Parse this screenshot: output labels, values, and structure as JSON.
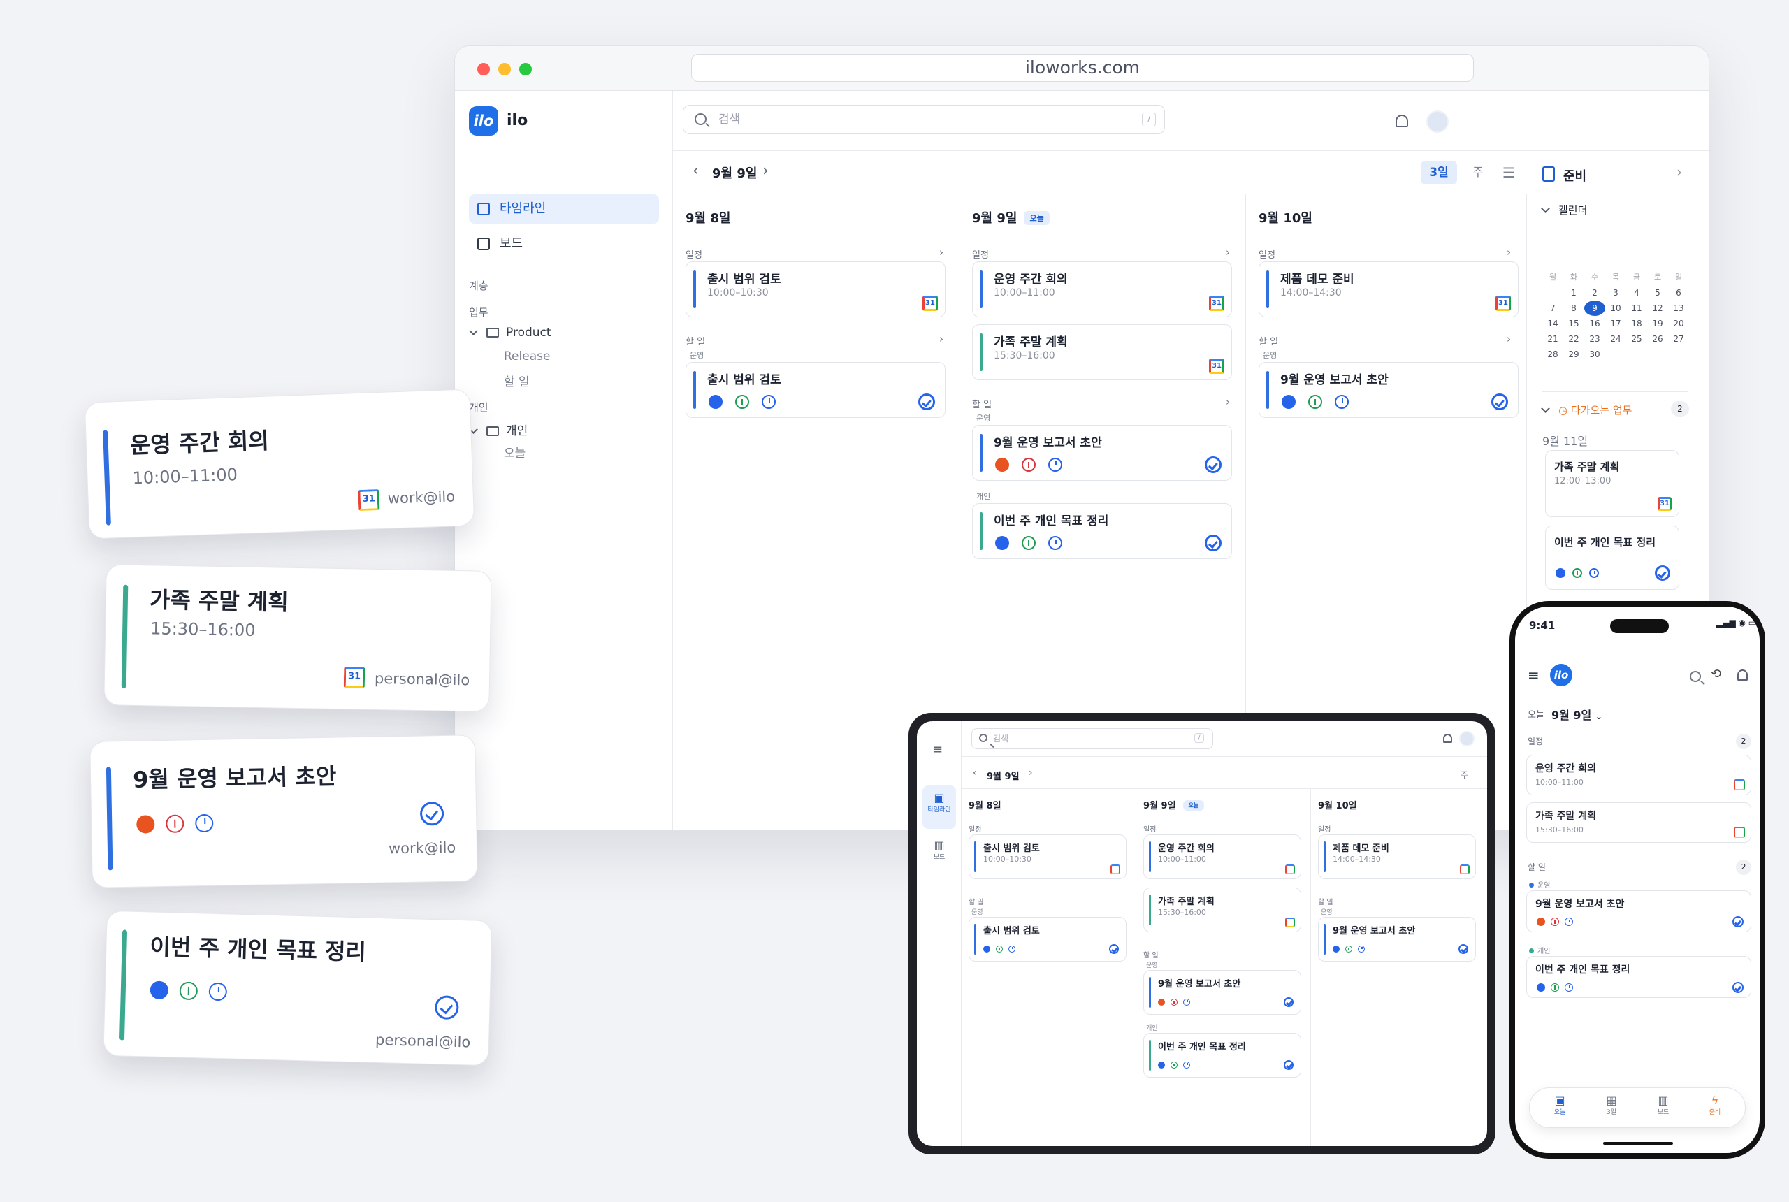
{
  "browser": {
    "url": "iloworks.com",
    "app_name": "ilo",
    "logo": "ilo",
    "nav": [
      "타임라인",
      "보드"
    ],
    "sections": {
      "hierarchy": "계층",
      "work": "업무",
      "personal": "개인"
    },
    "tree": {
      "product": "Product",
      "release": "Release",
      "todo": "할 일",
      "personal": "개인",
      "today": "오늘"
    },
    "search_placeholder": "검색",
    "search_shortcut": "/",
    "current_date": "9월 9일",
    "view_modes": [
      "3일",
      "주"
    ],
    "today_badge": "오늘",
    "group_events": "일정",
    "group_tasks": "할 일",
    "label_ops": "운영",
    "label_personal": "개인",
    "columns": [
      {
        "date": "9월 8일",
        "events": [
          {
            "title": "출시 범위 검토",
            "time": "10:00–10:30"
          }
        ],
        "tasks": [
          {
            "title": "출시 범위 검토"
          }
        ]
      },
      {
        "date": "9월 9일",
        "events": [
          {
            "title": "운영 주간 회의",
            "time": "10:00–11:00"
          },
          {
            "title": "가족 주말 계획",
            "time": "15:30–16:00"
          }
        ],
        "tasks": [
          {
            "title": "9월 운영 보고서 초안"
          },
          {
            "title": "이번 주 개인 목표 정리"
          }
        ]
      },
      {
        "date": "9월 10일",
        "events": [
          {
            "title": "제품 데모 준비",
            "time": "14:00–14:30"
          }
        ],
        "tasks": [
          {
            "title": "9월 운영 보고서 초안"
          }
        ]
      }
    ],
    "panel": {
      "title": "준비",
      "calendar": "캘린더",
      "weekdays": [
        "월",
        "화",
        "수",
        "목",
        "금",
        "토",
        "일"
      ],
      "weeks": [
        [
          "",
          "1",
          "2",
          "3",
          "4",
          "5",
          "6"
        ],
        [
          "7",
          "8",
          "9",
          "10",
          "11",
          "12",
          "13"
        ],
        [
          "14",
          "15",
          "16",
          "17",
          "18",
          "19",
          "20"
        ],
        [
          "21",
          "22",
          "23",
          "24",
          "25",
          "26",
          "27"
        ],
        [
          "28",
          "29",
          "30",
          "",
          "",
          "",
          ""
        ]
      ],
      "selected_day": "9",
      "upcoming": "다가오는 업무",
      "upcoming_count": "2",
      "upcoming_date": "9월 11일",
      "upcoming_event_title": "가족 주말 계획",
      "upcoming_event_time": "12:00–13:00",
      "upcoming_task": "이번 주 개인 목표 정리"
    },
    "gcal_label": "31"
  },
  "floating": [
    {
      "title": "운영 주간 회의",
      "time": "10:00–11:00",
      "account": "work@ilo"
    },
    {
      "title": "가족 주말 계획",
      "time": "15:30–16:00",
      "account": "personal@ilo"
    },
    {
      "title": "9월 운영 보고서 초안",
      "account": "work@ilo"
    },
    {
      "title": "이번 주 개인 목표 정리",
      "account": "personal@ilo"
    }
  ],
  "tablet": {
    "search": "검색",
    "shortcut": "/",
    "date": "9월 9일",
    "week": "주",
    "nav": [
      "타임라인",
      "보드"
    ],
    "today_badge": "오늘",
    "group_events": "일정",
    "group_tasks": "할 일",
    "label_ops": "운영",
    "label_personal": "개인",
    "columns": [
      {
        "date": "9월 8일",
        "e1": "출시 범위 검토",
        "t1": "10:00–10:30",
        "k1": "출시 범위 검토"
      },
      {
        "date": "9월 9일",
        "e1": "운영 주간 회의",
        "t1": "10:00–11:00",
        "e2": "가족 주말 계획",
        "t2": "15:30–16:00",
        "k1": "9월 운영 보고서 초안",
        "k2": "이번 주 개인 목표 정리"
      },
      {
        "date": "9월 10일",
        "e1": "제품 데모 준비",
        "t1": "14:00–14:30",
        "k1": "9월 운영 보고서 초안"
      }
    ]
  },
  "phone": {
    "time": "9:41",
    "today": "오늘",
    "date": "9월 9일",
    "events_label": "일정",
    "events_count": "2",
    "events": [
      {
        "title": "운영 주간 회의",
        "time": "10:00–11:00"
      },
      {
        "title": "가족 주말 계획",
        "time": "15:30–16:00"
      }
    ],
    "tasks_label": "할 일",
    "tasks_count": "2",
    "ops": "운영",
    "personal": "개인",
    "tasks": [
      "9월 운영 보고서 초안",
      "이번 주 개인 목표 정리"
    ],
    "tabs": [
      "오늘",
      "3일",
      "보드",
      "준비"
    ]
  },
  "colors": {
    "accent": "#1f6fe8",
    "work_bar": "#2f6fe0",
    "personal_bar": "#3aa98f"
  }
}
